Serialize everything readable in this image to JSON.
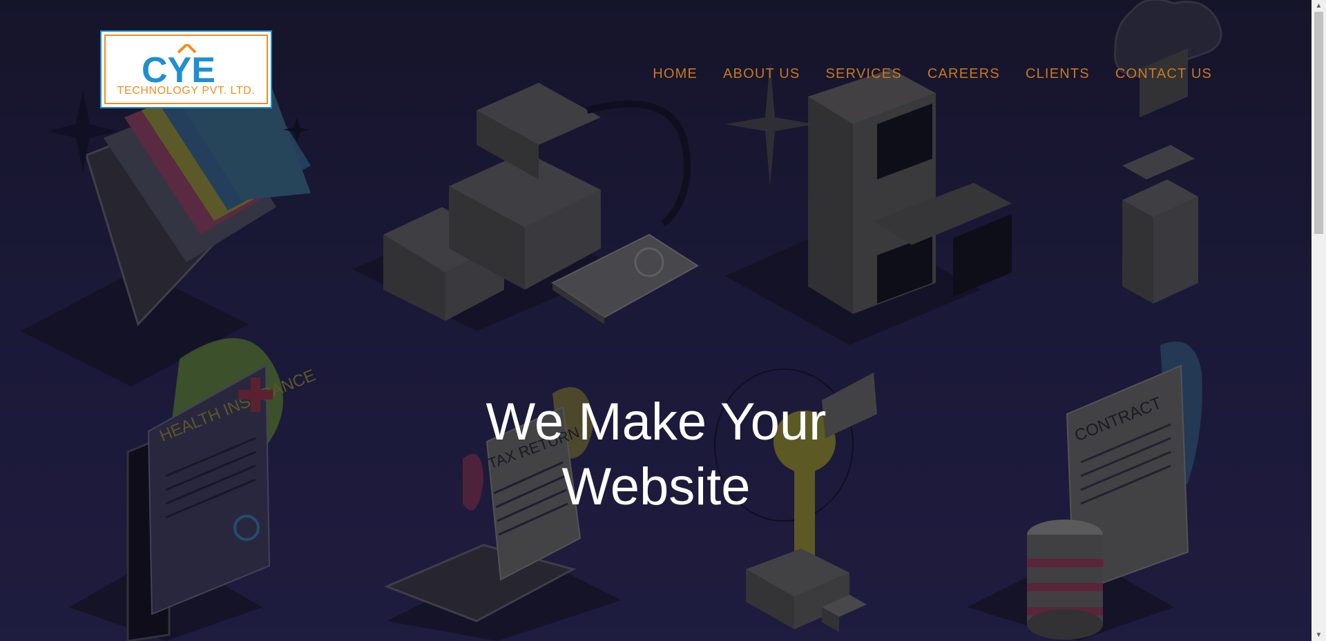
{
  "logo": {
    "mark_text": "CYE",
    "company": "TECHNOLOGY PVT. LTD."
  },
  "nav": {
    "items": [
      "HOME",
      "ABOUT US",
      "SERVICES",
      "CAREERS",
      "CLIENTS",
      "CONTACT US"
    ]
  },
  "hero": {
    "line1": "We Make Your",
    "line2": "Website"
  },
  "illustrations": {
    "health_title": "HEALTH INSURANCE",
    "tax_title": "TAX RETURN",
    "contract_title": "CONTRACT"
  },
  "colors": {
    "background": "#1c1a37",
    "nav_text": "#c7791d",
    "hero_text": "#ffffff",
    "logo_orange": "#f28c1e",
    "logo_blue": "#1f8fd1"
  }
}
